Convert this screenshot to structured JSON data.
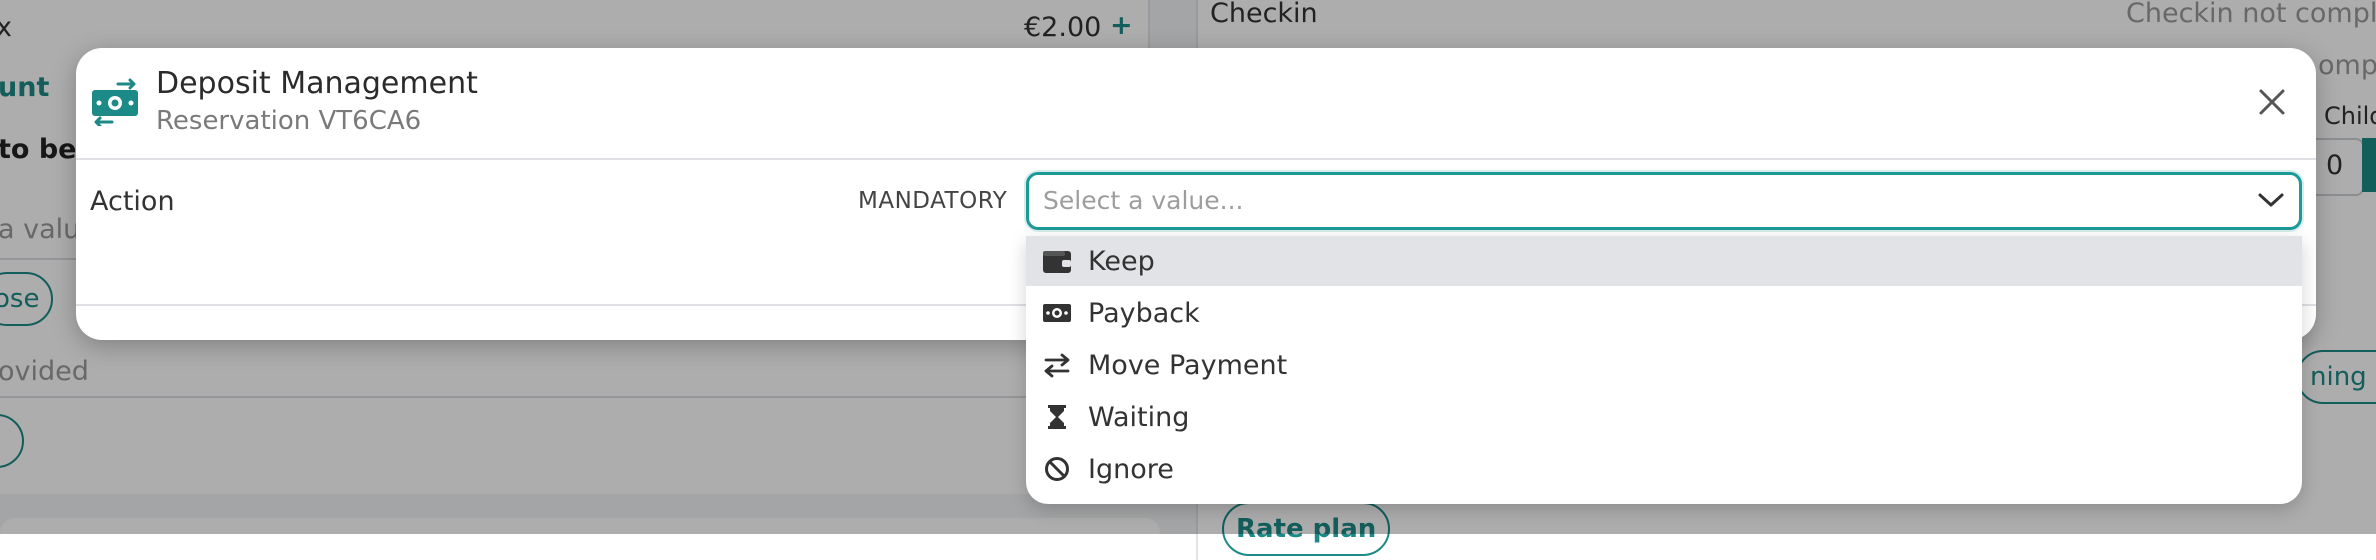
{
  "background": {
    "amount": "€2.00",
    "plus": "+",
    "close_mark": "x",
    "left_teal_text": "unt",
    "left_bold_text": "to be",
    "left_input_value": "a valu",
    "left_button": "ose",
    "left_muted": "ovided",
    "checkin_label": "Checkin",
    "checkin_status": "Checkin not complet",
    "right_partial_1": "ompl",
    "right_partial_2": "Childr",
    "right_stepper_value": "0",
    "right_pill": "ning c",
    "rate_plan": "Rate plan"
  },
  "modal": {
    "title": "Deposit Management",
    "subtitle": "Reservation VT6CA6",
    "header_icon": "money-exchange-icon",
    "close_icon": "close-icon"
  },
  "action": {
    "label": "Action",
    "mandatory": "MANDATORY",
    "placeholder": "Select a value..."
  },
  "options": [
    {
      "label": "Keep",
      "icon": "wallet-icon"
    },
    {
      "label": "Payback",
      "icon": "money-bill-icon"
    },
    {
      "label": "Move Payment",
      "icon": "exchange-arrows-icon"
    },
    {
      "label": "Waiting",
      "icon": "hourglass-icon"
    },
    {
      "label": "Ignore",
      "icon": "ban-icon"
    }
  ],
  "colors": {
    "accent": "#1c8a87",
    "focus_border": "#1c9a97",
    "highlight": "#e1e3e6"
  }
}
